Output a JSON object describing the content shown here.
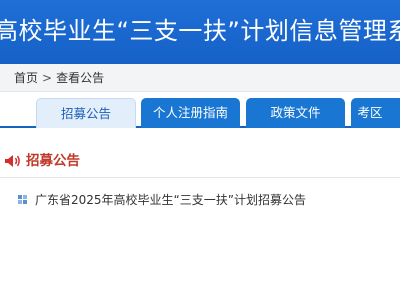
{
  "header": {
    "title": "高校毕业生“三支一扶”计划信息管理系统（考"
  },
  "breadcrumb": {
    "home": "首页",
    "separator": ">",
    "current": "查看公告"
  },
  "tabs": [
    {
      "label": "招募公告",
      "active": true
    },
    {
      "label": "个人注册指南",
      "active": false
    },
    {
      "label": "政策文件",
      "active": false
    },
    {
      "label": "考区",
      "active": false
    }
  ],
  "section": {
    "title": "招募公告",
    "icon": "speaker-icon"
  },
  "announcements": [
    {
      "title": "广东省2025年高校毕业生“三支一扶”计划招募公告",
      "icon": "grid-bullet-icon"
    }
  ],
  "colors": {
    "header_bg": "#1f6fd6",
    "tab_active_bg": "#e3eefb",
    "tab_bg": "#1976d2",
    "section_title": "#c0392b"
  }
}
